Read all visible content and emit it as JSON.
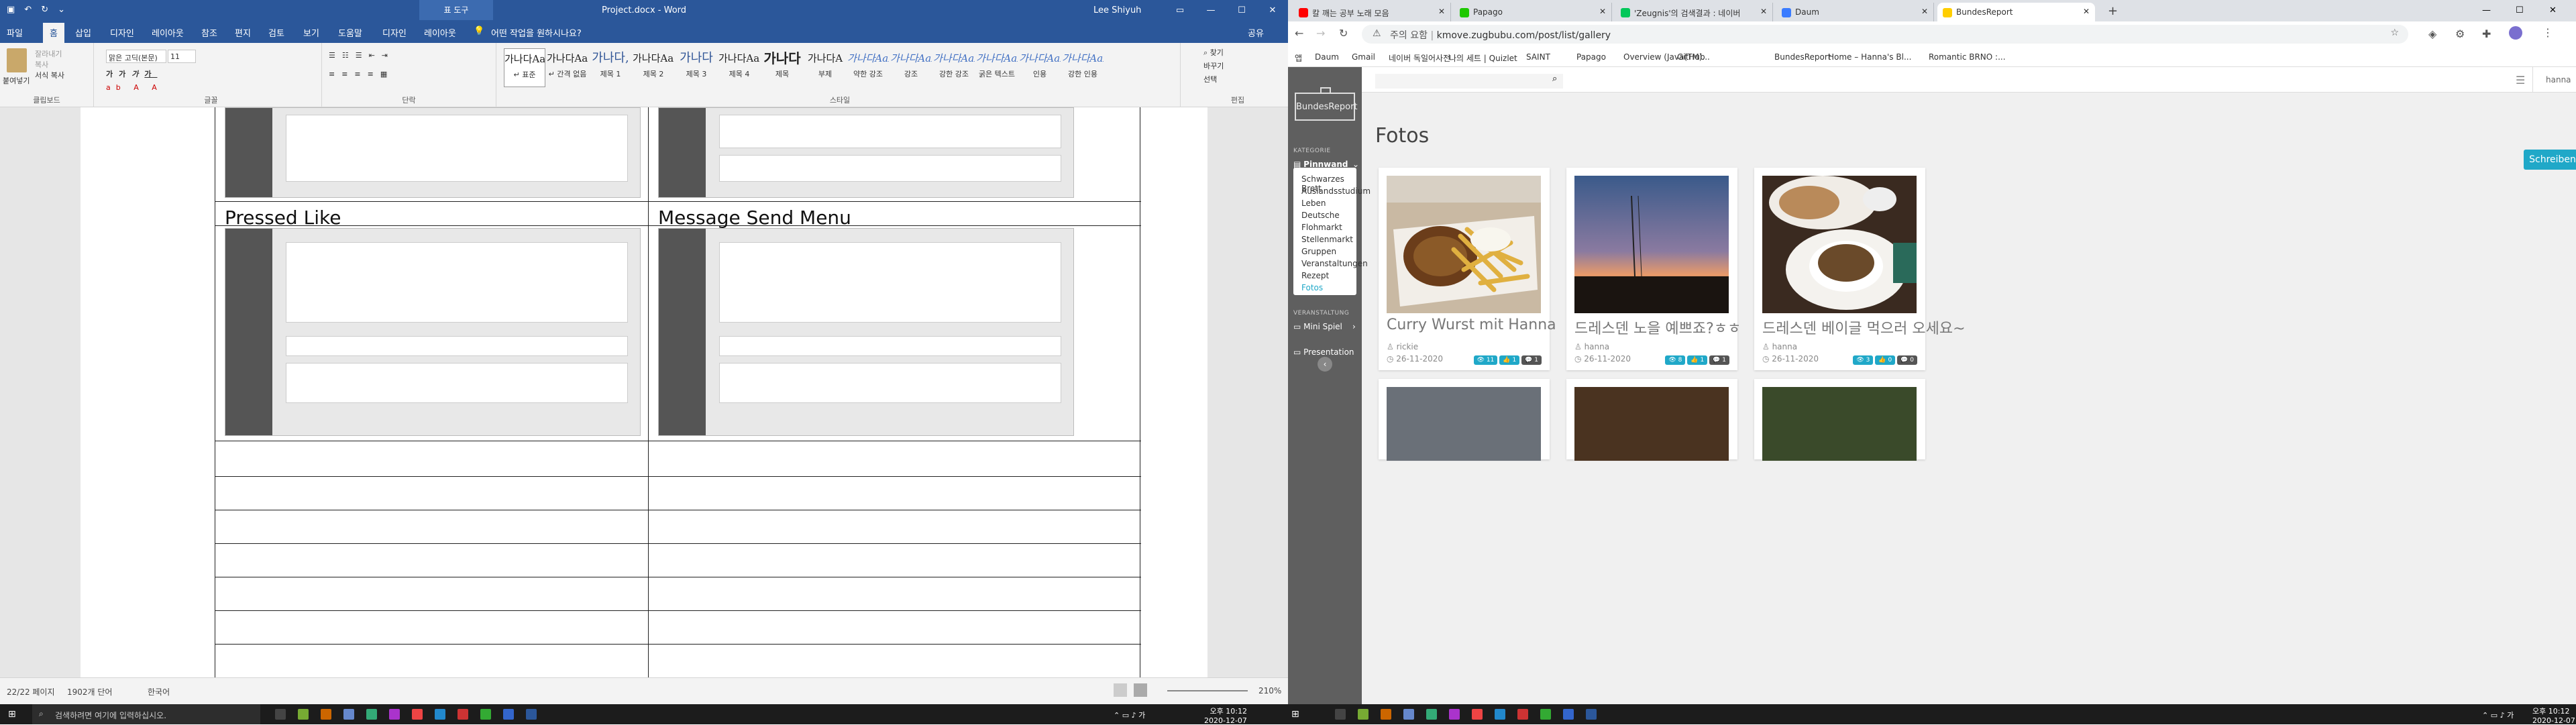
{
  "word": {
    "title": "Project.docx - Word",
    "context_tab": "표 도구",
    "user": "Lee Shiyuh",
    "tabs": [
      "파일",
      "홈",
      "삽입",
      "디자인",
      "레이아웃",
      "참조",
      "편지",
      "검토",
      "보기",
      "도움말",
      "디자인",
      "레이아웃"
    ],
    "tell_me": "어떤 작업을 원하시나요?",
    "share": "공유",
    "ribbon": {
      "clipboard": {
        "label": "클립보드",
        "paste": "붙여넣기",
        "cut": "잘라내기",
        "copy": "복사",
        "format_painter": "서식 복사"
      },
      "font": {
        "label": "글꼴",
        "name": "맑은 고딕(본문)",
        "size": "11"
      },
      "paragraph": {
        "label": "단락"
      },
      "styles": {
        "label": "스타일",
        "items": [
          {
            "preview": "가나다AaI",
            "name": "↵ 표준"
          },
          {
            "preview": "가나다AaI",
            "name": "↵ 간격 없음"
          },
          {
            "preview": "가나다,",
            "name": "제목 1"
          },
          {
            "preview": "가나다AaI",
            "name": "제목 2"
          },
          {
            "preview": "가나다",
            "name": "제목 3"
          },
          {
            "preview": "가나다AaI",
            "name": "제목 4"
          },
          {
            "preview": "가나다",
            "name": "제목"
          },
          {
            "preview": "가나다A",
            "name": "부제"
          },
          {
            "preview": "가나다AaI",
            "name": "약한 강조"
          },
          {
            "preview": "가나다AaI",
            "name": "강조"
          },
          {
            "preview": "가나다AaI",
            "name": "강한 강조"
          },
          {
            "preview": "가나다AaI",
            "name": "굵은 텍스트"
          },
          {
            "preview": "가나다AaI",
            "name": "인용"
          },
          {
            "preview": "가나다AaI",
            "name": "강한 인용"
          }
        ]
      },
      "editing": {
        "label": "편집",
        "find": "찾기",
        "replace": "바꾸기",
        "select": "선택"
      }
    },
    "table": {
      "cell1": "Pressed Like",
      "cell2": "Message Send Menu"
    },
    "status": {
      "page": "22/22 페이지",
      "words": "1902개 단어",
      "lang": "한국어",
      "zoom": "210%"
    }
  },
  "browser": {
    "tabs": [
      {
        "title": "칼 깨는 공부 노래 모음",
        "color": "#ff0000"
      },
      {
        "title": "Papago",
        "color": "#1ec800"
      },
      {
        "title": "'Zeugnis'의 검색결과 : 네이버",
        "color": "#03c75a"
      },
      {
        "title": "Daum",
        "color": "#3b7cff"
      },
      {
        "title": "BundesReport",
        "color": "#ffce00"
      }
    ],
    "url_prefix": "주의 요함",
    "url": "kmove.zugbubu.com/post/list/gallery",
    "bookmarks": [
      "앱",
      "Daum",
      "Gmail",
      "네이버 독일어사전",
      "나의 세트 | Quizlet",
      "SAINT",
      "Papago",
      "Overview (Java(TM)...",
      "GitHub",
      "BundesReport",
      "Home – Hanna's Bl...",
      "Romantic BRNO :..."
    ],
    "site": {
      "logo": "BundesReport",
      "section1": "KATEGORIE",
      "pinnwand": "Pinnwand",
      "submenu": [
        "Schwarzes Brett",
        "Auslandsstudium",
        "Leben",
        "Deutsche",
        "Flohmarkt",
        "Stellenmarkt",
        "Gruppen",
        "Veranstaltungen",
        "Rezept",
        "Fotos"
      ],
      "section2": "VERANSTALTUNG",
      "minispiel": "Mini Spiel",
      "presentation": "Presentation",
      "user": "hanna",
      "page_title": "Fotos",
      "write_button": "Schreiben",
      "cards": [
        {
          "title": "Curry Wurst mit Hanna",
          "author": "rickie",
          "date": "26-11-2020",
          "views": "11",
          "likes": "1",
          "comments": "1"
        },
        {
          "title": "드레스덴 노을 예쁘죠?ㅎㅎ",
          "author": "hanna",
          "date": "26-11-2020",
          "views": "8",
          "likes": "1",
          "comments": "1"
        },
        {
          "title": "드레스덴 베이글 먹으러 오세요~",
          "author": "hanna",
          "date": "26-11-2020",
          "views": "3",
          "likes": "0",
          "comments": "0"
        }
      ]
    }
  },
  "taskbar": {
    "search": "검색하려면 여기에 입력하십시오.",
    "time_left": "오후 10:12",
    "date_left": "2020-12-07",
    "time_right": "오후 10:12",
    "date_right": "2020-12-07"
  }
}
